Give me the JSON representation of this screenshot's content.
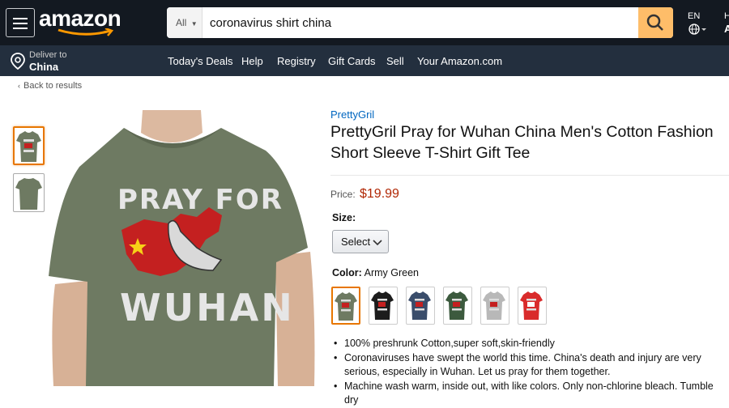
{
  "header": {
    "logo_text": "amazon",
    "search": {
      "department": "All",
      "query": "coronavirus shirt china"
    },
    "language": "EN",
    "account_letter_top": "H",
    "account_letter_bottom": "A"
  },
  "deliver": {
    "label": "Deliver to",
    "location": "China"
  },
  "nav": {
    "links": [
      "Today's Deals",
      "Help",
      "Registry",
      "Gift Cards",
      "Sell",
      "Your Amazon.com"
    ]
  },
  "breadcrumb": {
    "back": "Back to results"
  },
  "product": {
    "brand": "PrettyGril",
    "title": "PrettyGril Pray for Wuhan China Men's Cotton Fashion Short Sleeve T-Shirt Gift Tee",
    "price_label": "Price:",
    "price": "$19.99",
    "size_label": "Size:",
    "size_select": "Select",
    "color_label": "Color:",
    "color_value": "Army Green",
    "shirt_text_top": "PRAY FOR",
    "shirt_text_bottom": "WUHAN",
    "swatch_colors": [
      "#6e7a62",
      "#1c1c1c",
      "#3a4d6b",
      "#3c5a3e",
      "#b8b8b8",
      "#d92b2b"
    ],
    "bullets": [
      "100% preshrunk Cotton,super soft,skin-friendly",
      "Coronaviruses have swept the world this time. China's death and injury are very serious, especially in Wuhan. Let us pray for them together.",
      "Machine wash warm, inside out, with like colors. Only non-chlorine bleach. Tumble dry"
    ]
  },
  "colors": {
    "header_bg": "#131921",
    "nav_bg": "#232f3e",
    "search_btn": "#febd69",
    "price": "#b12704",
    "brand_link": "#0066c0",
    "shirt": "#6e7a62"
  }
}
